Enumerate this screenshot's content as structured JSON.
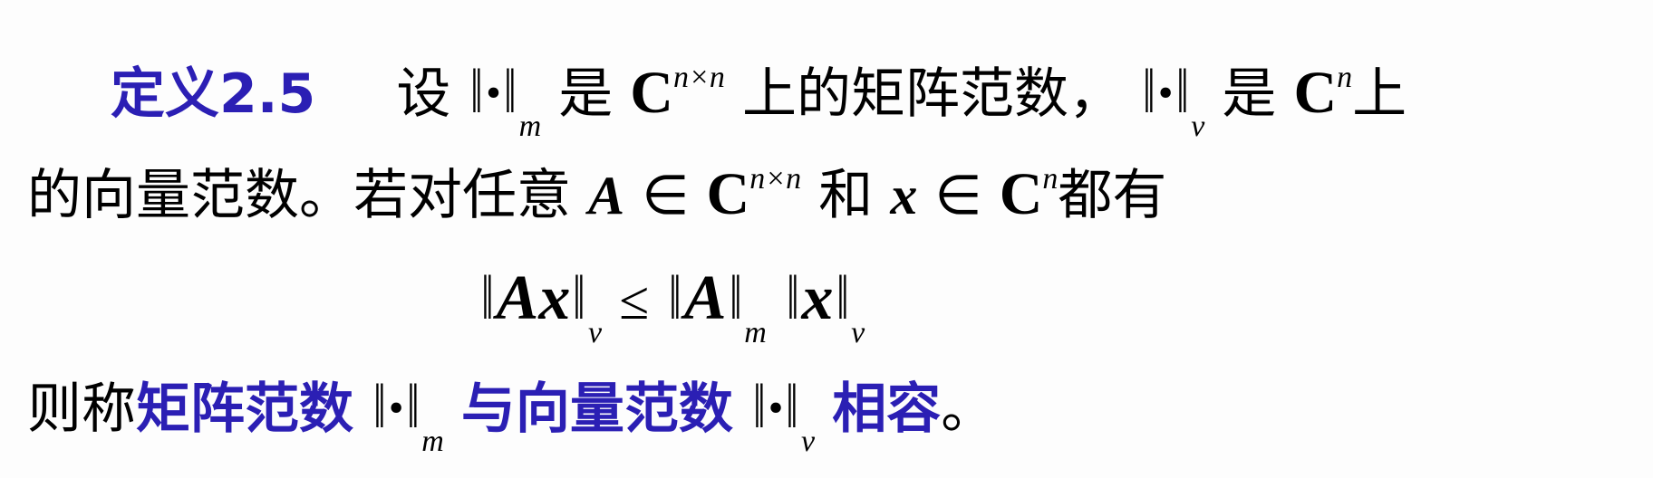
{
  "definition": {
    "label": "定义2.5",
    "line1": {
      "t1": "设",
      "t2": "是",
      "C": "C",
      "sup1": "n×n",
      "t3": "上的矩阵范数，",
      "t4": "是",
      "sup2": "n",
      "t5": "上"
    },
    "line2": {
      "t1": "的向量范数。若对任意",
      "A": "A",
      "in": "∈",
      "C": "C",
      "sup1": "n×n",
      "t2": "和",
      "x": "x",
      "sup2": "n",
      "t3": "都有"
    },
    "formula": {
      "Ax": "Ax",
      "leq": "≤",
      "A": "A",
      "x": "x"
    },
    "line4": {
      "t1": "则称",
      "t2": "矩阵范数",
      "t3": "与向量范数",
      "t4": "相容",
      "t5": "。"
    },
    "norm": {
      "bar": "‖",
      "dot": "•",
      "m": "m",
      "v": "v"
    }
  },
  "colors": {
    "accent": "#2b1fb4"
  }
}
